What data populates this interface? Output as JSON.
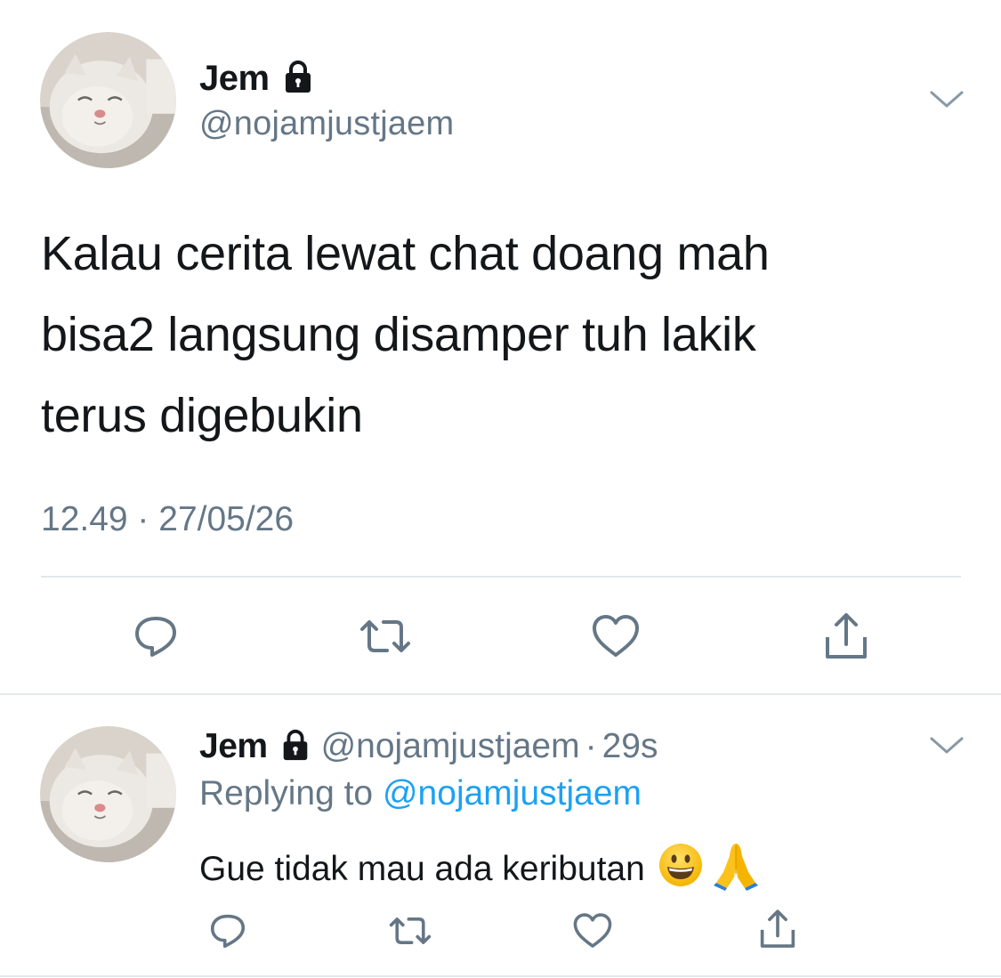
{
  "main_tweet": {
    "author": {
      "display_name": "Jem",
      "handle": "@nojamjustjaem",
      "protected": true,
      "avatar": "cat-avatar"
    },
    "text_lines": [
      "Kalau cerita lewat chat doang mah",
      "bisa2 langsung disamper tuh lakik",
      "terus digebukin"
    ],
    "timestamp": "12.49 · 27/05/26",
    "actions": [
      "reply-icon",
      "retweet-icon",
      "like-icon",
      "share-icon"
    ],
    "menu_icon": "chevron-down-icon"
  },
  "reply": {
    "author": {
      "display_name": "Jem",
      "handle": "@nojamjustjaem",
      "protected": true,
      "avatar": "cat-avatar"
    },
    "separator": "·",
    "time": "29s",
    "replying_prefix": "Replying to",
    "replying_to": "@nojamjustjaem",
    "text": "Gue tidak mau ada keributan",
    "emojis": [
      "grinning-face-emoji",
      "folded-hands-emoji"
    ],
    "actions": [
      "reply-icon",
      "retweet-icon",
      "like-icon",
      "share-icon"
    ],
    "menu_icon": "chevron-down-icon"
  },
  "colors": {
    "text_primary": "#14171a",
    "text_secondary": "#657786",
    "link": "#1da1f2",
    "divider": "#e1e8ed",
    "icon": "#657786"
  }
}
